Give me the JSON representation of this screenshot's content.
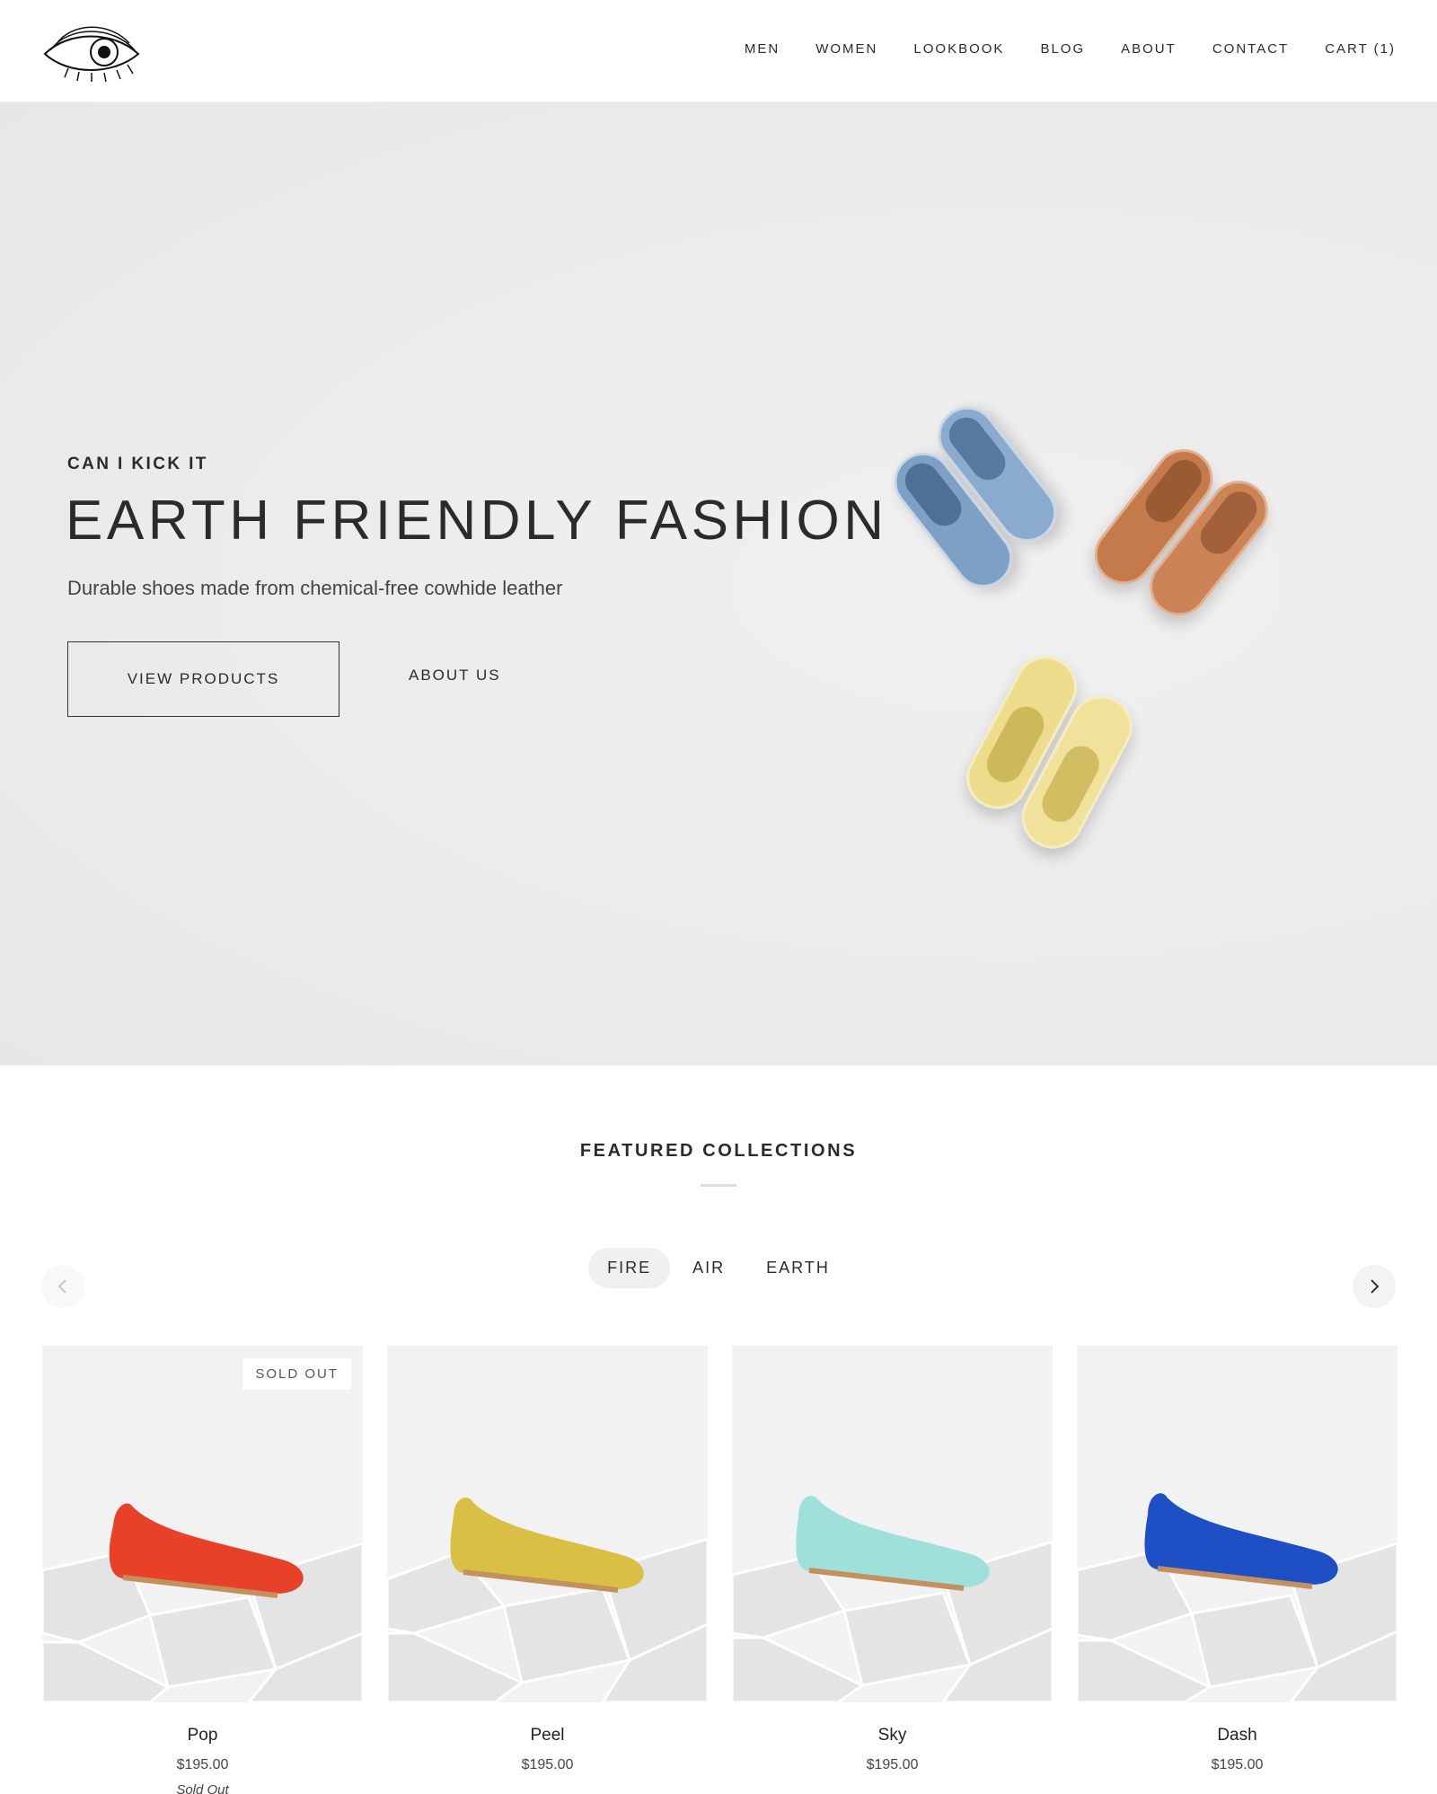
{
  "header": {
    "logo_icon": "eye-logo-icon",
    "nav": [
      "MEN",
      "WOMEN",
      "LOOKBOOK",
      "BLOG",
      "ABOUT",
      "CONTACT",
      "CART (1)"
    ]
  },
  "hero": {
    "eyebrow": "CAN I KICK IT",
    "title": "EARTH FRIENDLY FASHION",
    "subtitle": "Durable shoes made from chemical-free cowhide leather",
    "primary_button": "VIEW PRODUCTS",
    "secondary_link": "ABOUT US"
  },
  "featured": {
    "title": "FEATURED COLLECTIONS",
    "tabs": [
      "FIRE",
      "AIR",
      "EARTH"
    ],
    "active_tab": "FIRE",
    "products": [
      {
        "name": "Pop",
        "price": "$195.00",
        "badge": "SOLD OUT",
        "note": "Sold Out",
        "color": "#e8412a"
      },
      {
        "name": "Peel",
        "price": "$195.00",
        "badge": "",
        "note": "",
        "color": "#d9c044"
      },
      {
        "name": "Sky",
        "price": "$195.00",
        "badge": "",
        "note": "",
        "color": "#9fe0da"
      },
      {
        "name": "Dash",
        "price": "$195.00",
        "badge": "",
        "note": "",
        "color": "#1f4fc4"
      }
    ]
  },
  "colors": {
    "hero_bg": "#ebebec",
    "text": "#2b2b2b",
    "shoe_blue": "#7ea0c4",
    "shoe_tan": "#c47a4c",
    "shoe_yellow": "#ecdc8c"
  }
}
